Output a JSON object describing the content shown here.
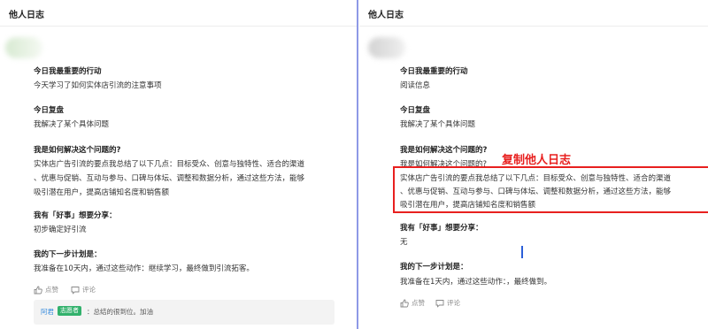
{
  "left": {
    "title": "他人日志",
    "section1_heading": "今日我最重要的行动",
    "section1_body": "今天学习了如何实体店引流的注意事项",
    "section2_heading": "今日复盘",
    "section2_body": "我解决了某个具体问题",
    "section3_heading": "我是如何解决这个问题的?",
    "section3_lines": [
      "实体店广告引流的要点我总结了以下几点：目标受众、创意与独特性、适合的渠道",
      "、优惠与促销、互动与参与、口碑与体坛、调整和数据分析，通过这些方法，能够",
      "吸引潜在用户，提高店铺知名度和销售额"
    ],
    "section4_heading": "我有「好事」想要分享：",
    "section4_body": "初步确定好引流",
    "section5_heading": "我的下一步计划是：",
    "section5_body": "我准备在10天内，通过这些动作：继续学习，最终做到引流拓客。",
    "like_label": "点赞",
    "comment_label": "评论",
    "comment": {
      "author": "阿君",
      "badge": "志愿者",
      "text": "：总结的很到位。加油"
    }
  },
  "right": {
    "title": "他人日志",
    "section1_heading": "今日我最重要的行动",
    "section1_body": "阅读信息",
    "section2_heading": "今日复盘",
    "section2_body": "我解决了某个具体问题",
    "section3_heading": "我是如何解决这个问题的?",
    "section3_line0": "我是如何解决这个问题的?",
    "section3_lines": [
      "实体店广告引流的要点我总结了以下几点：目标受众、创意与独特性、适合的渠道",
      "、优惠与促销、互动与参与、口碑与体坛、调整和数据分析，通过这些方法，能够",
      "吸引潜在用户，提高店铺知名度和销售额"
    ],
    "section4_heading": "我有「好事」想要分享：",
    "section4_body": "无",
    "section5_heading": "我的下一步计划是：",
    "section5_body": "我准备在1天内，通过这些动作：，最终做到。",
    "like_label": "点赞",
    "comment_label": "评论"
  },
  "annotation": {
    "label": "复制他人日志",
    "color": "#e8201f"
  },
  "icons": {
    "like": "thumbs-up-icon",
    "comment": "comment-icon"
  }
}
